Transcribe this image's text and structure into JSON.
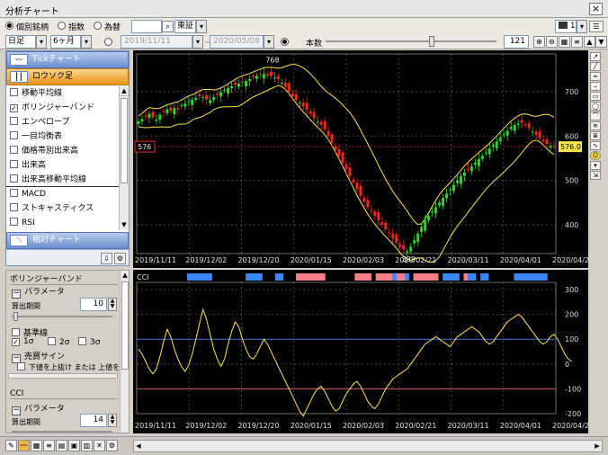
{
  "window": {
    "title": "分析チャート",
    "close": "×"
  },
  "toolbar1": {
    "opt_individual": "個別銘柄",
    "opt_index": "指数",
    "opt_fx": "為替",
    "exchange": "東証",
    "panel_count": "1"
  },
  "toolbar2": {
    "period": "日足",
    "range": "6ヶ月",
    "date_from": "2019/11/11",
    "date_to": "2020/05/08",
    "bars_label": "本数",
    "bars_value": "121"
  },
  "left_panel": {
    "tick_chart": "Tickチャート",
    "candle": "ロウソク足",
    "relative_chart": "相対チャート",
    "indicators": [
      {
        "label": "移動平均線",
        "checked": false
      },
      {
        "label": "ボリンジャーバンド",
        "checked": true
      },
      {
        "label": "エンベロープ",
        "checked": false
      },
      {
        "label": "一目均衡表",
        "checked": false
      },
      {
        "label": "価格帯別出来高",
        "checked": false
      },
      {
        "label": "出来高",
        "checked": false
      },
      {
        "label": "出来高移動平均線",
        "checked": false
      },
      {
        "label": "MACD",
        "checked": false
      },
      {
        "label": "ストキャスティクス",
        "checked": false
      },
      {
        "label": "RSI",
        "checked": false
      }
    ]
  },
  "settings": {
    "boll_title": "ボリンジャーバンド",
    "param_label": "パラメータ",
    "period_label": "算出期間",
    "boll_period": "10",
    "baseline_label": "基準線",
    "sigma1": "1σ",
    "sigma2": "2σ",
    "sigma3": "3σ",
    "signal_label": "売買サイン",
    "signal_text": "下値を上抜け または 上値を",
    "cci_title": "CCI",
    "cci_param_label": "パラメータ",
    "cci_period_label": "算出期間",
    "cci_period": "14"
  },
  "chart_data": [
    {
      "type": "candlestick",
      "title": "",
      "x_labels": [
        "2019/11/11",
        "2019/12/02",
        "2019/12/20",
        "2020/01/15",
        "2020/02/03",
        "2020/02/21",
        "2020/03/11",
        "2020/04/01",
        "2020/04/20"
      ],
      "y_ticks": [
        400,
        500,
        600,
        700
      ],
      "ylim": [
        335,
        785
      ],
      "annotations": {
        "high": "768",
        "low": "333",
        "current_line": "576",
        "last_price": "576.0"
      },
      "close": [
        633,
        638,
        645,
        650,
        642,
        637,
        648,
        655,
        660,
        657,
        663,
        660,
        670,
        673,
        678,
        682,
        686,
        690,
        688,
        682,
        681,
        688,
        693,
        699,
        704,
        708,
        712,
        715,
        718,
        720,
        724,
        728,
        733,
        736,
        738,
        740,
        737,
        735,
        732,
        728,
        720,
        711,
        700,
        690,
        681,
        675,
        667,
        660,
        650,
        640,
        632,
        625,
        615,
        600,
        585,
        570,
        555,
        540,
        525,
        510,
        495,
        480,
        465,
        452,
        440,
        430,
        420,
        410,
        400,
        390,
        380,
        370,
        360,
        350,
        345,
        340,
        350,
        365,
        380,
        395,
        410,
        420,
        430,
        440,
        450,
        460,
        470,
        480,
        490,
        500,
        510,
        518,
        525,
        532,
        540,
        548,
        555,
        563,
        572,
        580,
        588,
        597,
        605,
        612,
        620,
        625,
        628,
        630,
        625,
        618,
        610,
        602,
        595,
        588,
        582,
        578,
        576
      ],
      "cci": [
        60,
        40,
        10,
        -20,
        -40,
        -20,
        30,
        90,
        140,
        110,
        60,
        20,
        -10,
        -30,
        -5,
        40,
        100,
        160,
        220,
        180,
        120,
        60,
        20,
        -10,
        20,
        80,
        130,
        170,
        150,
        100,
        60,
        30,
        20,
        40,
        70,
        100,
        80,
        50,
        20,
        -10,
        -40,
        -70,
        -100,
        -130,
        -160,
        -190,
        -210,
        -180,
        -150,
        -120,
        -100,
        -90,
        -110,
        -140,
        -170,
        -190,
        -180,
        -150,
        -120,
        -100,
        -80,
        -70,
        -90,
        -120,
        -150,
        -170,
        -180,
        -160,
        -130,
        -100,
        -80,
        -60,
        -50,
        -40,
        -30,
        -20,
        0,
        20,
        40,
        60,
        80,
        90,
        100,
        110,
        100,
        90,
        80,
        70,
        90,
        110,
        120,
        130,
        140,
        150,
        140,
        130,
        110,
        90,
        80,
        90,
        110,
        130,
        150,
        170,
        180,
        190,
        200,
        190,
        170,
        150,
        130,
        110,
        90,
        80,
        90,
        110,
        120,
        100,
        70,
        40,
        20,
        10
      ],
      "cci_y_ticks": [
        300,
        200,
        100,
        0,
        -100,
        -200
      ],
      "cci_label": "CCI",
      "upper_color": "#f7e64a",
      "band_color": "#f7e64a",
      "up_color": "#2dd22d",
      "down_color": "#ef2626"
    }
  ],
  "cci_signals": {
    "buy_color": "#3b86f5",
    "sell_color": "#f47e86",
    "buy_spans": [
      [
        0.12,
        0.18
      ],
      [
        0.26,
        0.3
      ],
      [
        0.33,
        0.35
      ],
      [
        0.6,
        0.65
      ],
      [
        0.73,
        0.77
      ],
      [
        0.79,
        0.81
      ],
      [
        0.82,
        0.84
      ],
      [
        0.9,
        0.98
      ]
    ],
    "sell_spans": [
      [
        0.38,
        0.45
      ],
      [
        0.52,
        0.56
      ],
      [
        0.57,
        0.61
      ],
      [
        0.62,
        0.64
      ],
      [
        0.66,
        0.72
      ],
      [
        0.78,
        0.79
      ]
    ]
  },
  "icons": [
    "search-icon",
    "dropdown-icon",
    "scroll-up-icon",
    "scroll-down-icon",
    "smile-icon"
  ]
}
